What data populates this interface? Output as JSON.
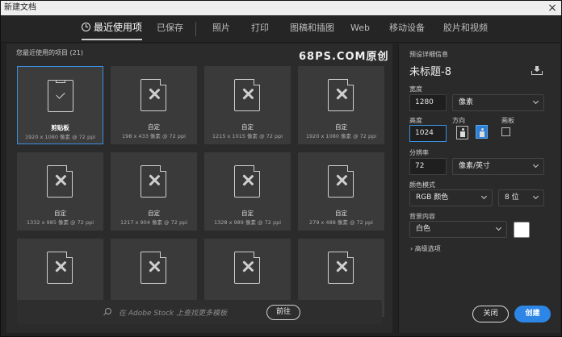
{
  "window": {
    "title": "新建文档",
    "close_glyph": "×"
  },
  "tabs": [
    {
      "label": "最近使用项",
      "active": true,
      "icon": "clock-icon"
    },
    {
      "label": "已保存"
    },
    {
      "label": "照片"
    },
    {
      "label": "打印"
    },
    {
      "label": "图稿和插图"
    },
    {
      "label": "Web"
    },
    {
      "label": "移动设备"
    },
    {
      "label": "胶片和视频"
    }
  ],
  "recent": {
    "heading": "您最近使用的项目 (21)",
    "watermark": "68PS.COM原创",
    "items": [
      {
        "name": "剪贴板",
        "size": "1920 x 1080 像素 @ 72 ppi",
        "icon": "clipboard-doc-icon",
        "selected": true
      },
      {
        "name": "自定",
        "size": "198 x 433 像素 @ 72 ppi",
        "icon": "custom-doc-icon"
      },
      {
        "name": "自定",
        "size": "1215 x 1015 像素 @ 72 ppi",
        "icon": "custom-doc-icon"
      },
      {
        "name": "自定",
        "size": "1920 x 1080 像素 @ 72 ppi",
        "icon": "custom-doc-icon"
      },
      {
        "name": "自定",
        "size": "1332 x 985 像素 @ 72 ppi",
        "icon": "custom-doc-icon"
      },
      {
        "name": "自定",
        "size": "1217 x 904 像素 @ 72 ppi",
        "icon": "custom-doc-icon"
      },
      {
        "name": "自定",
        "size": "1328 x 989 像素 @ 72 ppi",
        "icon": "custom-doc-icon"
      },
      {
        "name": "自定",
        "size": "279 x 488 像素 @ 72 ppi",
        "icon": "custom-doc-icon"
      },
      {
        "name": "",
        "size": "",
        "icon": "custom-doc-icon"
      },
      {
        "name": "",
        "size": "",
        "icon": "custom-doc-icon"
      },
      {
        "name": "",
        "size": "",
        "icon": "custom-doc-icon"
      },
      {
        "name": "",
        "size": "",
        "icon": "custom-doc-icon"
      }
    ]
  },
  "stock": {
    "placeholder": "在 Adobe Stock 上查找更多模板",
    "go_label": "前往"
  },
  "details": {
    "section_label": "预设详细信息",
    "doc_title": "未标题-8",
    "width_label": "宽度",
    "width_value": "1280",
    "width_unit": "像素",
    "height_label": "高度",
    "height_value": "1024",
    "orientation_label": "方向",
    "artboard_label": "画板",
    "resolution_label": "分辨率",
    "resolution_value": "72",
    "resolution_unit": "像素/英寸",
    "color_mode_label": "颜色模式",
    "color_mode_value": "RGB 颜色",
    "bit_depth_value": "8 位",
    "background_label": "背景内容",
    "background_value": "白色",
    "advanced_label": "› 高级选项",
    "close_label": "关闭",
    "create_label": "创建"
  },
  "colors": {
    "accent": "#2d86e6",
    "selected_border": "#3a8fe0",
    "background_swatch": "#ffffff"
  }
}
